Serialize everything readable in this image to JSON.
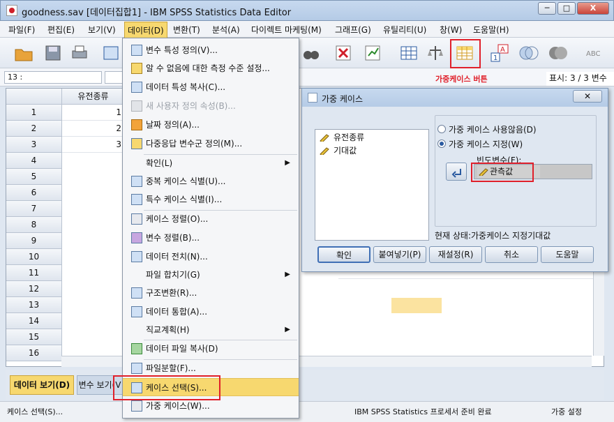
{
  "window": {
    "title": "goodness.sav [데이터집합1] - IBM SPSS Statistics Data Editor",
    "minimize": "─",
    "maximize": "□",
    "close": "X"
  },
  "menubar": [
    "파일(F)",
    "편집(E)",
    "보기(V)",
    "데이터(D)",
    "변환(T)",
    "분석(A)",
    "다이렉트 마케팅(M)",
    "그래프(G)",
    "유틸리티(U)",
    "창(W)",
    "도움말(H)"
  ],
  "cellbar": {
    "ref": "13 :",
    "show": "표시: 3 / 3 변수"
  },
  "annotation": "가중케이스 버튼",
  "grid": {
    "col1": "유전종류",
    "rows": [
      "1",
      "2",
      "3",
      "4",
      "5",
      "6",
      "7",
      "8",
      "9",
      "10",
      "11",
      "12",
      "13",
      "14",
      "15",
      "16"
    ],
    "values": [
      "1",
      "2",
      "3"
    ]
  },
  "tabs": {
    "data": "데이터 보기(D)",
    "var": "변수 보기(V"
  },
  "status": {
    "left": "케이스 선택(S)...",
    "middle": "IBM SPSS Statistics 프로세서 준비 완료",
    "right": "가중 설정"
  },
  "menu": [
    {
      "label": "변수 특성 정의(V)...",
      "disabled": false
    },
    {
      "label": "알 수 없음에 대한 측정 수준 설정...",
      "disabled": false
    },
    {
      "label": "데이터 특성 복사(C)...",
      "disabled": false
    },
    {
      "label": "새 사용자 정의 속성(B)...",
      "disabled": true
    },
    {
      "label": "날짜 정의(A)...",
      "disabled": false
    },
    {
      "label": "다중응답 변수군 정의(M)...",
      "disabled": false
    },
    {
      "label": "확인(L)",
      "disabled": false
    },
    {
      "label": "중복 케이스 식별(U)...",
      "disabled": false
    },
    {
      "label": "특수 케이스 식별(I)...",
      "disabled": false
    },
    {
      "label": "케이스 정렬(O)...",
      "disabled": false
    },
    {
      "label": "변수 정렬(B)...",
      "disabled": false
    },
    {
      "label": "데이터 전치(N)...",
      "disabled": false
    },
    {
      "label": "파일 합치기(G)",
      "disabled": false
    },
    {
      "label": "구조변환(R)...",
      "disabled": false
    },
    {
      "label": "데이터 통합(A)...",
      "disabled": false
    },
    {
      "label": "직교계획(H)",
      "disabled": false
    },
    {
      "label": "데이터 파일 복사(D)",
      "disabled": false
    },
    {
      "label": "파일분할(F)...",
      "disabled": false
    },
    {
      "label": "케이스 선택(S)...",
      "disabled": false
    },
    {
      "label": "가중 케이스(W)...",
      "disabled": false
    }
  ],
  "dialog": {
    "title": "가중 케이스",
    "close": "✕",
    "vars": [
      "유전종류",
      "기대값"
    ],
    "radio_none": "가중 케이스 사용않음(D)",
    "radio_weight": "가중 케이스 지정(W)",
    "freq_label": "빈도변수(F):",
    "freq_value": "관측값",
    "current": "현재 상태:가중케이스 지정기대값",
    "buttons": [
      "확인",
      "붙여넣기(P)",
      "재설정(R)",
      "취소",
      "도움말"
    ]
  },
  "colors": {
    "accent": "#f7d86f",
    "red": "#e0202a"
  }
}
